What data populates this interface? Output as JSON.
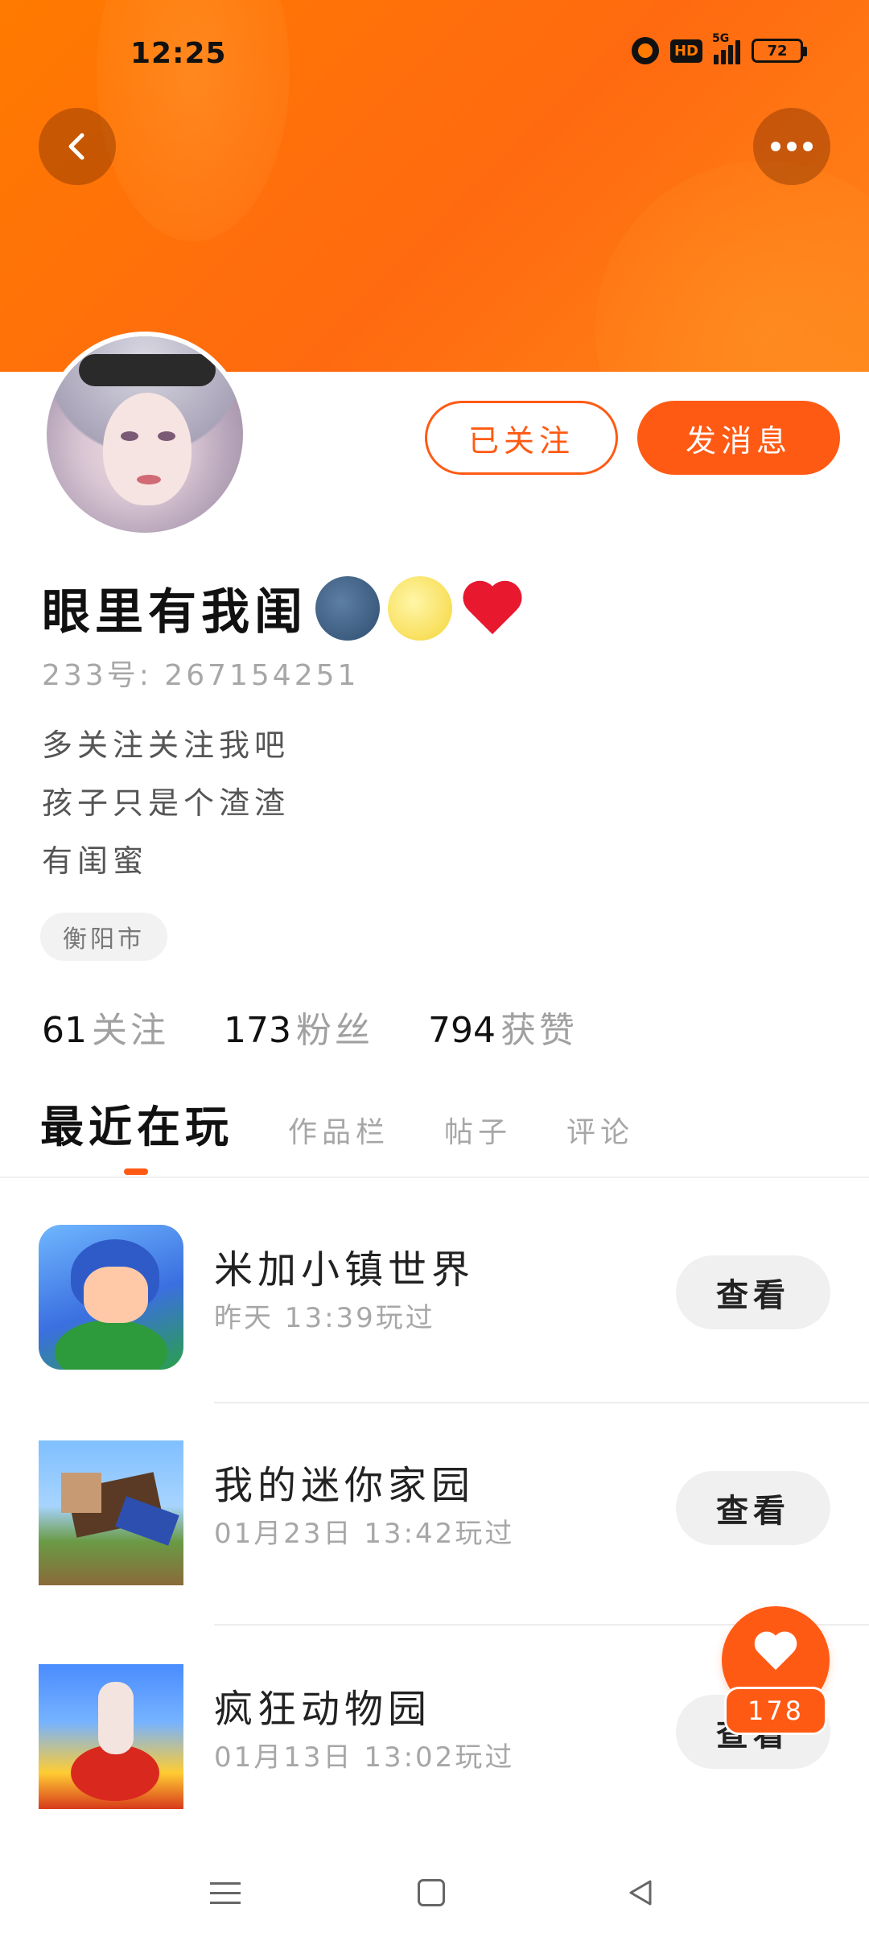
{
  "status_bar": {
    "time": "12:25",
    "network": "5G",
    "hd": "HD",
    "battery": "72"
  },
  "header": {
    "back_icon": "chevron-left-icon",
    "more_icon": "more-dots-icon",
    "banner_color": "#ff7a00"
  },
  "profile": {
    "follow_button": "已关注",
    "message_button": "发消息",
    "username": "眼里有我闺",
    "emojis": [
      "new-moon-face",
      "full-moon-face",
      "red-heart"
    ],
    "uid": "233号: 267154251",
    "bio_lines": [
      "多关注关注我吧",
      "孩子只是个渣渣",
      "有闺蜜"
    ],
    "location": "衡阳市",
    "stats": [
      {
        "num": "61",
        "label": "关注"
      },
      {
        "num": "173",
        "label": "粉丝"
      },
      {
        "num": "794",
        "label": "获赞"
      }
    ],
    "accent_color": "#ff5a14"
  },
  "tabs": [
    {
      "label": "最近在玩",
      "active": true
    },
    {
      "label": "作品栏",
      "active": false
    },
    {
      "label": "帖子",
      "active": false
    },
    {
      "label": "评论",
      "active": false
    }
  ],
  "games": [
    {
      "title": "米加小镇世界",
      "time": "昨天 13:39玩过",
      "button": "查看"
    },
    {
      "title": "我的迷你家园",
      "time": "01月23日 13:42玩过",
      "button": "查看"
    },
    {
      "title": "疯狂动物园",
      "time": "01月13日 13:02玩过",
      "button": "查看"
    }
  ],
  "like": {
    "icon": "heart-icon",
    "count": "178"
  },
  "nav": {
    "menu_icon": "menu-icon",
    "home_icon": "home-square-icon",
    "back_icon": "back-triangle-icon"
  }
}
